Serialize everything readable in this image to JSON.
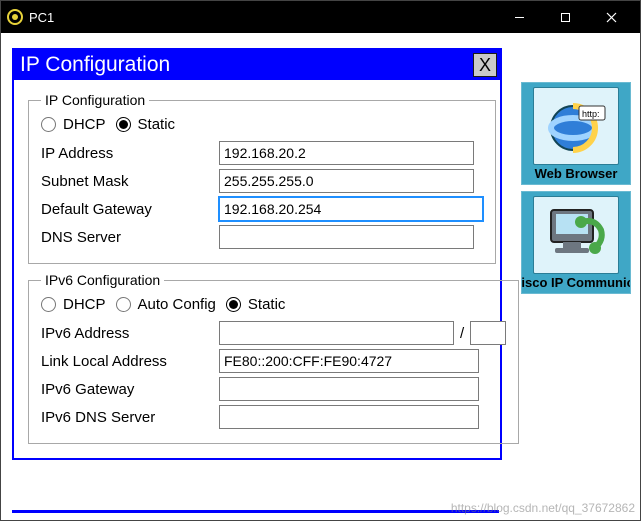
{
  "window": {
    "title": "PC1"
  },
  "dialog": {
    "title": "IP Configuration",
    "close_glyph": "X"
  },
  "ipv4": {
    "legend": "IP Configuration",
    "mode_dhcp_label": "DHCP",
    "mode_static_label": "Static",
    "selected_mode": "static",
    "fields": {
      "ip_label": "IP Address",
      "ip_value": "192.168.20.2",
      "mask_label": "Subnet Mask",
      "mask_value": "255.255.255.0",
      "gw_label": "Default Gateway",
      "gw_value": "192.168.20.254",
      "dns_label": "DNS Server",
      "dns_value": ""
    }
  },
  "ipv6": {
    "legend": "IPv6 Configuration",
    "mode_dhcp_label": "DHCP",
    "mode_auto_label": "Auto Config",
    "mode_static_label": "Static",
    "selected_mode": "static",
    "fields": {
      "addr_label": "IPv6 Address",
      "addr_value": "",
      "prefix_value": "",
      "ll_label": "Link Local Address",
      "ll_value": "FE80::200:CFF:FE90:4727",
      "gw_label": "IPv6 Gateway",
      "gw_value": "",
      "dns_label": "IPv6 DNS Server",
      "dns_value": ""
    },
    "slash": "/"
  },
  "dock": {
    "web": {
      "caption": "Web Browser"
    },
    "phone": {
      "caption": "Cisco IP Communicator"
    }
  },
  "watermark": "https://blog.csdn.net/qq_37672862"
}
